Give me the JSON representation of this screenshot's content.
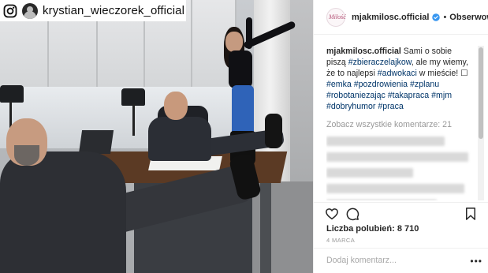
{
  "overlay": {
    "username": "krystian_wieczorek_official"
  },
  "post": {
    "header": {
      "avatar_text": "Miłość",
      "username": "mjakmilosc.official",
      "dot": "•",
      "follow_label": "Obserwowa"
    },
    "caption": {
      "username": "mjakmilosc.official",
      "segments": [
        {
          "text": "Sami o sobie piszą ",
          "tag": false
        },
        {
          "text": "#zbieraczelajkow",
          "tag": true
        },
        {
          "text": ", ale my wiemy, że to najlepsi ",
          "tag": false
        },
        {
          "text": "#adwokaci",
          "tag": true
        },
        {
          "text": " w mieście! ☐ ",
          "tag": false
        },
        {
          "text": "#emka",
          "tag": true
        },
        {
          "text": " ",
          "tag": false
        },
        {
          "text": "#pozdrowienia",
          "tag": true
        },
        {
          "text": " ",
          "tag": false
        },
        {
          "text": "#zplanu",
          "tag": true
        },
        {
          "text": " ",
          "tag": false
        },
        {
          "text": "#robotaniezając",
          "tag": true
        },
        {
          "text": " ",
          "tag": false
        },
        {
          "text": "#takapraca",
          "tag": true
        },
        {
          "text": " ",
          "tag": false
        },
        {
          "text": "#mjm",
          "tag": true
        },
        {
          "text": " ",
          "tag": false
        },
        {
          "text": "#dobryhumor",
          "tag": true
        },
        {
          "text": " ",
          "tag": false
        },
        {
          "text": "#praca",
          "tag": true
        }
      ]
    },
    "view_all_comments": "Zobacz wszystkie komentarze: 21",
    "likes_label": "Liczba polubień: 8 710",
    "date": "4 MARCA",
    "add_comment_placeholder": "Dodaj komentarz...",
    "more_label": "•••",
    "icons": {
      "like": "heart-icon",
      "comment": "comment-icon",
      "save": "bookmark-icon",
      "verified": "verified-badge-icon",
      "instagram": "instagram-icon"
    },
    "colors": {
      "link": "#003569",
      "verified": "#3897f0",
      "meta": "#999999"
    }
  }
}
